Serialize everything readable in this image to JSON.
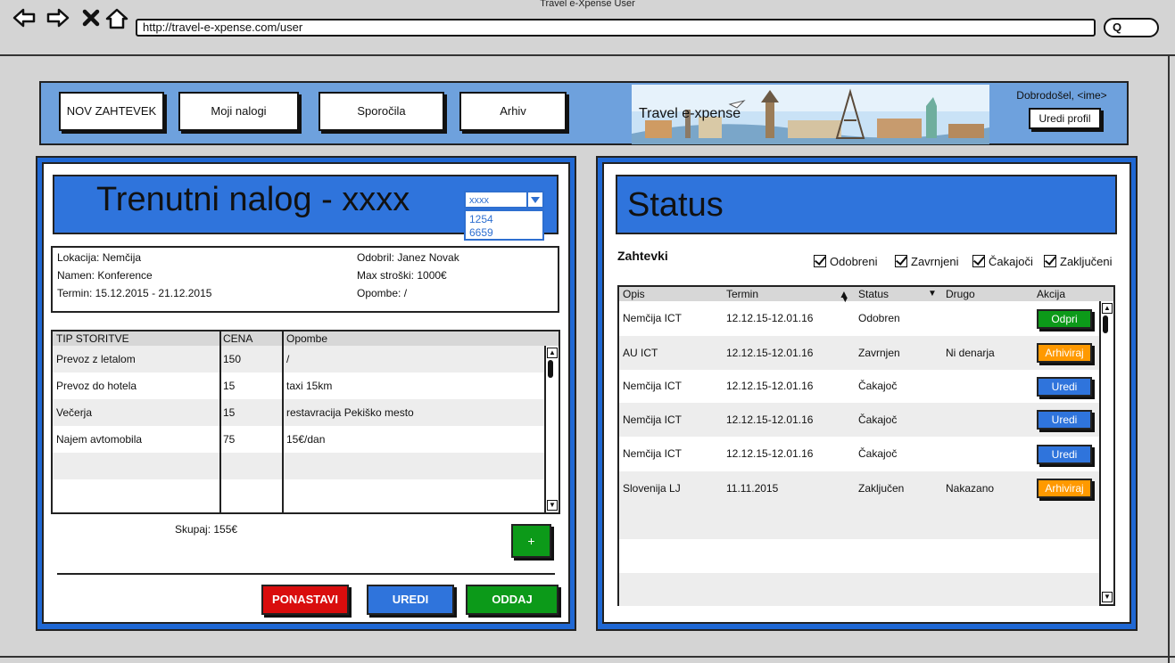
{
  "window": {
    "title": "Travel e-Xpense User"
  },
  "browser": {
    "url": "http://travel-e-xpense.com/user"
  },
  "colors": {
    "header_blue": "#6ea1dd",
    "panel_blue": "#1f68d4",
    "accent_blue": "#2f74dc",
    "green": "#0c9a19",
    "orange": "#ff9900",
    "red": "#d90d0d"
  },
  "nav": {
    "new_request": "NOV ZAHTEVEK",
    "my_orders": "Moji nalogi",
    "messages": "Sporočila",
    "archive": "Arhiv"
  },
  "brand": {
    "banner_text": "Travel e-xpense"
  },
  "user": {
    "welcome": "Dobrodošel, <ime>",
    "edit_profile": "Uredi profil"
  },
  "current": {
    "title": "Trenutni nalog - xxxx",
    "selector": {
      "selected": "xxxx",
      "options": [
        "1254",
        "6659"
      ]
    },
    "info": {
      "location": "Lokacija: Nemčija",
      "purpose": "Namen: Konference",
      "term": "Termin: 15.12.2015 - 21.12.2015",
      "approved_by": "Odobril: Janez Novak",
      "max_cost": "Max stroški: 1000€",
      "notes": "Opombe: /"
    },
    "services": {
      "headers": [
        "TIP STORITVE",
        "CENA",
        "Opombe"
      ],
      "rows": [
        [
          "Prevoz z letalom",
          "150",
          "/"
        ],
        [
          "Prevoz do hotela",
          "15",
          "taxi 15km"
        ],
        [
          "Večerja",
          "15",
          "restavracija Pekiško mesto"
        ],
        [
          "Najem avtomobila",
          "75",
          "15€/dan"
        ]
      ]
    },
    "total": "Skupaj: 155€",
    "add_label": "+",
    "reset_label": "PONASTAVI",
    "edit_label": "UREDI",
    "submit_label": "ODDAJ"
  },
  "status": {
    "title": "Status",
    "section_label": "Zahtevki",
    "filters": [
      "Odobreni",
      "Zavrnjeni",
      "Čakajoči",
      "Zaključeni"
    ],
    "headers": [
      "Opis",
      "Termin",
      "Status",
      "Drugo",
      "Akcija"
    ],
    "rows": [
      {
        "desc": "Nemčija ICT",
        "term": "12.12.15-12.01.16",
        "status": "Odobren",
        "other": "",
        "action": "Odpri",
        "action_color": "#0c9a19"
      },
      {
        "desc": "AU ICT",
        "term": "12.12.15-12.01.16",
        "status": "Zavrnjen",
        "other": "Ni denarja",
        "action": "Arhiviraj",
        "action_color": "#ff9900"
      },
      {
        "desc": "Nemčija ICT",
        "term": "12.12.15-12.01.16",
        "status": "Čakajoč",
        "other": "",
        "action": "Uredi",
        "action_color": "#2f74dc"
      },
      {
        "desc": "Nemčija ICT",
        "term": "12.12.15-12.01.16",
        "status": "Čakajoč",
        "other": "",
        "action": "Uredi",
        "action_color": "#2f74dc"
      },
      {
        "desc": "Nemčija ICT",
        "term": "12.12.15-12.01.16",
        "status": "Čakajoč",
        "other": "",
        "action": "Uredi",
        "action_color": "#2f74dc"
      },
      {
        "desc": "Slovenija LJ",
        "term": "11.11.2015",
        "status": "Zaključen",
        "other": "Nakazano",
        "action": "Arhiviraj",
        "action_color": "#ff9900"
      }
    ]
  }
}
